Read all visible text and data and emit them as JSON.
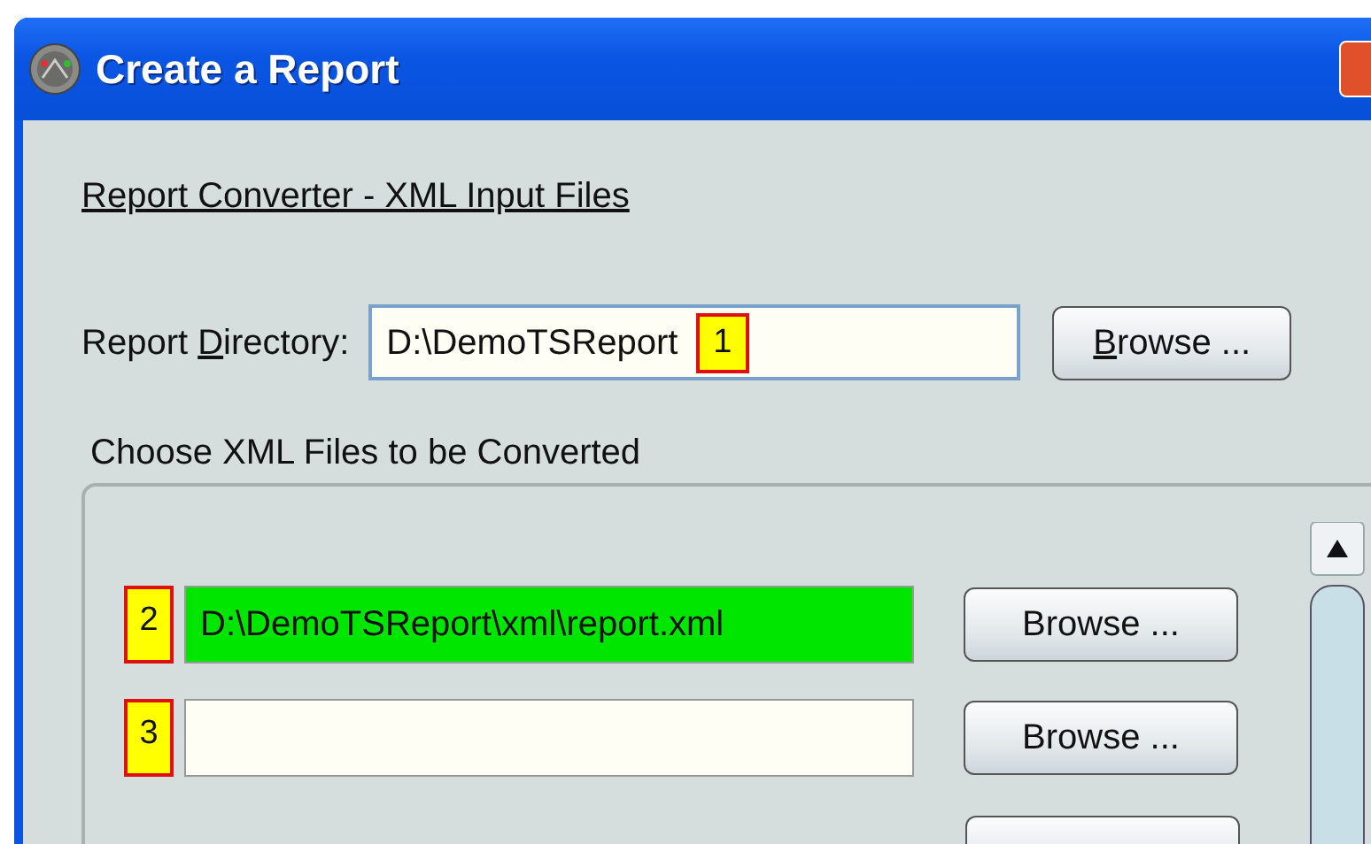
{
  "window": {
    "title": "Create a Report"
  },
  "heading": "Report Converter - XML Input Files",
  "directory": {
    "label_before": "Report ",
    "mnemonic": "D",
    "label_after": "irectory:",
    "value": "D:\\DemoTSReport",
    "marker": "1",
    "button": {
      "mnemonic": "B",
      "rest": "rowse ..."
    }
  },
  "files_group": {
    "title": "Choose XML Files to be Converted",
    "rows": [
      {
        "marker": "2",
        "value": "D:\\DemoTSReport\\xml\\report.xml",
        "highlighted": true,
        "button": "Browse ..."
      },
      {
        "marker": "3",
        "highlighted": false,
        "button": "Browse ..."
      }
    ]
  }
}
